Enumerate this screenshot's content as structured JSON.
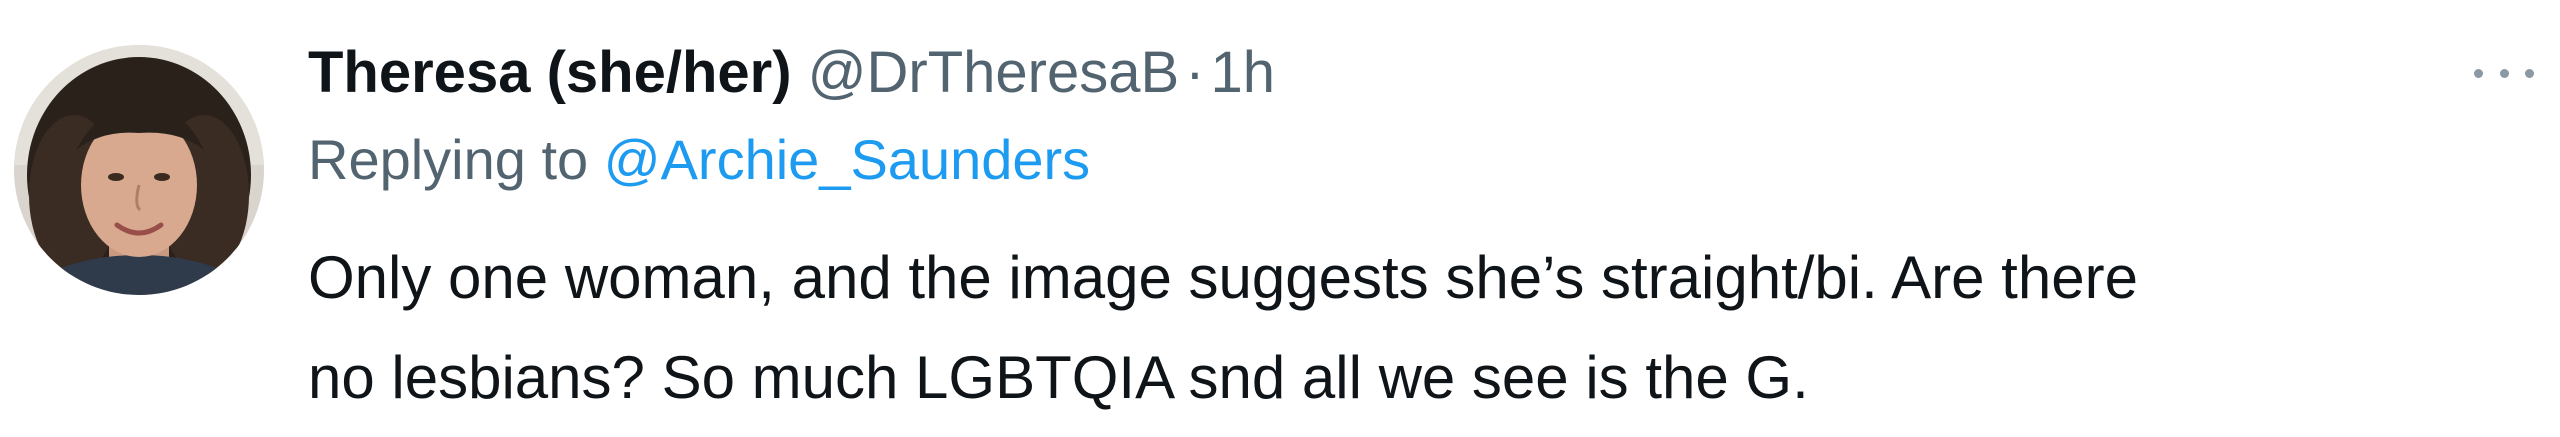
{
  "tweet": {
    "author": {
      "display_name": "Theresa (she/her)",
      "handle": "@DrTheresaB",
      "avatar_icon": "profile-photo"
    },
    "separator": "·",
    "timestamp": "1h",
    "replying_to_prefix": "Replying to",
    "replying_to_handle": "@Archie_Saunders",
    "text_lines": [
      "Only one woman, and the image suggests she’s straight/bi. Are there",
      "no lesbians? So much LGBTQIA snd all we see is the G."
    ],
    "more_icon": "ellipsis-icon",
    "colors": {
      "primary_text": "#0f1419",
      "secondary_text": "#536471",
      "link": "#1d9bf0",
      "background": "#ffffff"
    }
  }
}
